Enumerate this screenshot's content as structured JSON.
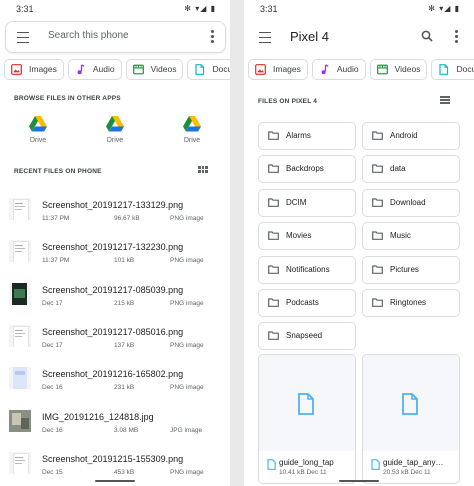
{
  "left": {
    "status": {
      "time": "3:31",
      "icons": "✻ ▾◢ ▮"
    },
    "search": {
      "placeholder": "Search this phone"
    },
    "chips": [
      {
        "label": "Images",
        "color": "#d93025"
      },
      {
        "label": "Audio",
        "color": "#9334e6"
      },
      {
        "label": "Videos",
        "color": "#1e8e3e"
      },
      {
        "label": "Docu",
        "color": "#12b5cb"
      }
    ],
    "browse_header": "BROWSE FILES IN OTHER APPS",
    "drives": [
      {
        "label": "Drive"
      },
      {
        "label": "Drive"
      },
      {
        "label": "Drive"
      }
    ],
    "recent_header": "RECENT FILES ON PHONE",
    "files": [
      {
        "name": "Screenshot_20191217-133129.png",
        "date": "11:37 PM",
        "size": "96.67 kB",
        "type": "PNG image",
        "thumb": "doc"
      },
      {
        "name": "Screenshot_20191217-132230.png",
        "date": "11:37 PM",
        "size": "101 kB",
        "type": "PNG image",
        "thumb": "doc"
      },
      {
        "name": "Screenshot_20191217-085039.png",
        "date": "Dec 17",
        "size": "215 kB",
        "type": "PNG image",
        "thumb": "dark"
      },
      {
        "name": "Screenshot_20191217-085016.png",
        "date": "Dec 17",
        "size": "137 kB",
        "type": "PNG image",
        "thumb": "doc"
      },
      {
        "name": "Screenshot_20191216-165802.png",
        "date": "Dec 16",
        "size": "231 kB",
        "type": "PNG image",
        "thumb": "blue"
      },
      {
        "name": "IMG_20191216_124818.jpg",
        "date": "Dec 16",
        "size": "3.08 MB",
        "type": "JPG image",
        "thumb": "photo"
      },
      {
        "name": "Screenshot_20191215-155309.png",
        "date": "Dec 15",
        "size": "453 kB",
        "type": "PNG image",
        "thumb": "doc"
      }
    ]
  },
  "right": {
    "status": {
      "time": "3:31",
      "icons": "✻ ▾◢ ▮"
    },
    "title": "Pixel 4",
    "chips": [
      {
        "label": "Images",
        "color": "#d93025"
      },
      {
        "label": "Audio",
        "color": "#9334e6"
      },
      {
        "label": "Videos",
        "color": "#1e8e3e"
      },
      {
        "label": "Docu",
        "color": "#12b5cb"
      }
    ],
    "files_header": "FILES ON PIXEL 4",
    "folders": [
      "Alarms",
      "Android",
      "Backdrops",
      "data",
      "DCIM",
      "Download",
      "Movies",
      "Music",
      "Notifications",
      "Pictures",
      "Podcasts",
      "Ringtones",
      "Snapseed"
    ],
    "cards": [
      {
        "name": "guide_long_tap",
        "meta": "10.41 kB  Dec 11"
      },
      {
        "name": "guide_tap_any…",
        "meta": "20.53 kB  Dec 11"
      }
    ]
  }
}
